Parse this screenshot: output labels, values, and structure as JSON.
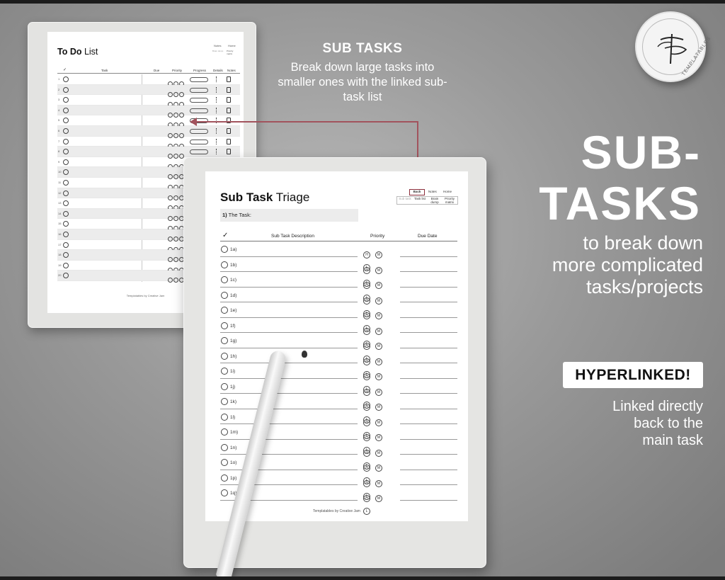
{
  "brand": {
    "logo_text": "TEMPLATABLES",
    "accent_color": "#a2535d"
  },
  "callout": {
    "title": "SUB TASKS",
    "body": "Break down large tasks into smaller ones with the linked sub-task list"
  },
  "headline": {
    "line1": "SUB-",
    "line2": "TASKS"
  },
  "subheadline": [
    "to break down",
    "more complicated",
    "tasks/projects"
  ],
  "badge": "HYPERLINKED!",
  "linked_text": [
    "Linked directly",
    "back to the",
    "main task"
  ],
  "todo_page": {
    "title_bold": "To Do",
    "title_light": " List",
    "nav": {
      "notes": "Notes",
      "home": "Home",
      "brain": "Brain dump",
      "priority": "Priority matrix"
    },
    "columns": [
      "✓",
      "Task",
      "Due",
      "Priority",
      "Progress",
      "Details",
      "Notes"
    ],
    "row_numbers": [
      "1",
      "2",
      "3",
      "4",
      "5",
      "6",
      "7",
      "8",
      "9",
      "10",
      "11",
      "12",
      "13",
      "14",
      "15",
      "16",
      "17",
      "18",
      "19",
      "20"
    ],
    "footer": "Templatables by Creative Jam"
  },
  "subtask_page": {
    "title_bold": "Sub Task",
    "title_light": " Triage",
    "task_number": "1)",
    "task_label": "The Task:",
    "nav": {
      "back": "Back",
      "notes": "Notes",
      "home": "Home",
      "sub_task": "Sub task",
      "task_list": "Task list",
      "brain": "Brain dump",
      "priority": "Priority matrix"
    },
    "columns": {
      "check": "✓",
      "description": "Sub Task Description",
      "priority": "Priority",
      "due": "Due Date"
    },
    "priority_levels": [
      "H",
      "M",
      "L"
    ],
    "rows": [
      "1a)",
      "1b)",
      "1c)",
      "1d)",
      "1e)",
      "1f)",
      "1g)",
      "1h)",
      "1i)",
      "1j)",
      "1k)",
      "1l)",
      "1m)",
      "1n)",
      "1o)",
      "1p)",
      "1q)"
    ],
    "footer": "Templatables by Creative Jam"
  }
}
